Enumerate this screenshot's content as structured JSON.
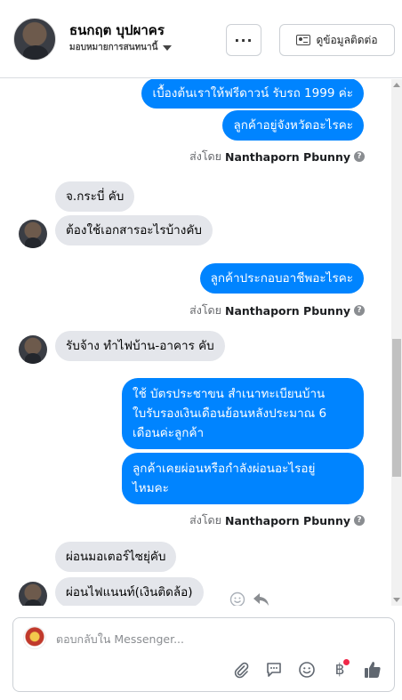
{
  "header": {
    "name": "ธนกฤต บุปผาคร",
    "role": "มอบหมายการสนทนานี้",
    "more_label": "···",
    "contact_label": "ดูข้อมูลติดต่อ"
  },
  "messages": [
    {
      "side": "out",
      "text": "เบื้องต้นเราให้ฟรีดาวน์ รับรถ 1999 ค่ะ"
    },
    {
      "side": "out",
      "text": "ลูกค้าอยู่จังหวัดอะไรคะ"
    },
    {
      "side": "in",
      "text": "จ.กระบี่ คับ"
    },
    {
      "side": "in",
      "text": "ต้องใช้เอกสารอะไรบ้างคับ"
    },
    {
      "side": "out",
      "text": "ลูกค้าประกอบอาชีพอะไรคะ"
    },
    {
      "side": "in",
      "text": "รับจ้าง ทำไฟบ้าน-อาคาร คับ"
    },
    {
      "side": "out",
      "lines": [
        "ใช้ บัตรประชาขน สำเนาทะเบียนบ้าน",
        "ใบรับรองเงินเดือนย้อนหลังประมาณ 6",
        "เดือนค่ะลูกค้า"
      ]
    },
    {
      "side": "out",
      "lines": [
        "ลูกค้าเคยผ่อนหรือกำลังผ่อนอะไรอยู่",
        "ไหมคะ"
      ]
    },
    {
      "side": "in",
      "text": "ผ่อนมอเตอร์ไซยุ่คับ"
    },
    {
      "side": "in",
      "text": "ผ่อนไฟแนนท์(เงินติดล้อ)"
    }
  ],
  "sent_by": {
    "prefix": "ส่งโดย",
    "agent": "Nanthaporn Pbunny",
    "help": "?"
  },
  "composer": {
    "placeholder": "ตอบกลับใน Messenger..."
  },
  "icons": {
    "attach": "paperclip-icon",
    "saved_replies": "chat-bubble-icon",
    "emoji": "emoji-icon",
    "payment": "baht-icon",
    "payment_symbol": "฿",
    "like": "thumbs-up-icon"
  },
  "colors": {
    "outgoing": "#0084ff",
    "incoming": "#e4e6eb",
    "like": "#1877f2"
  }
}
